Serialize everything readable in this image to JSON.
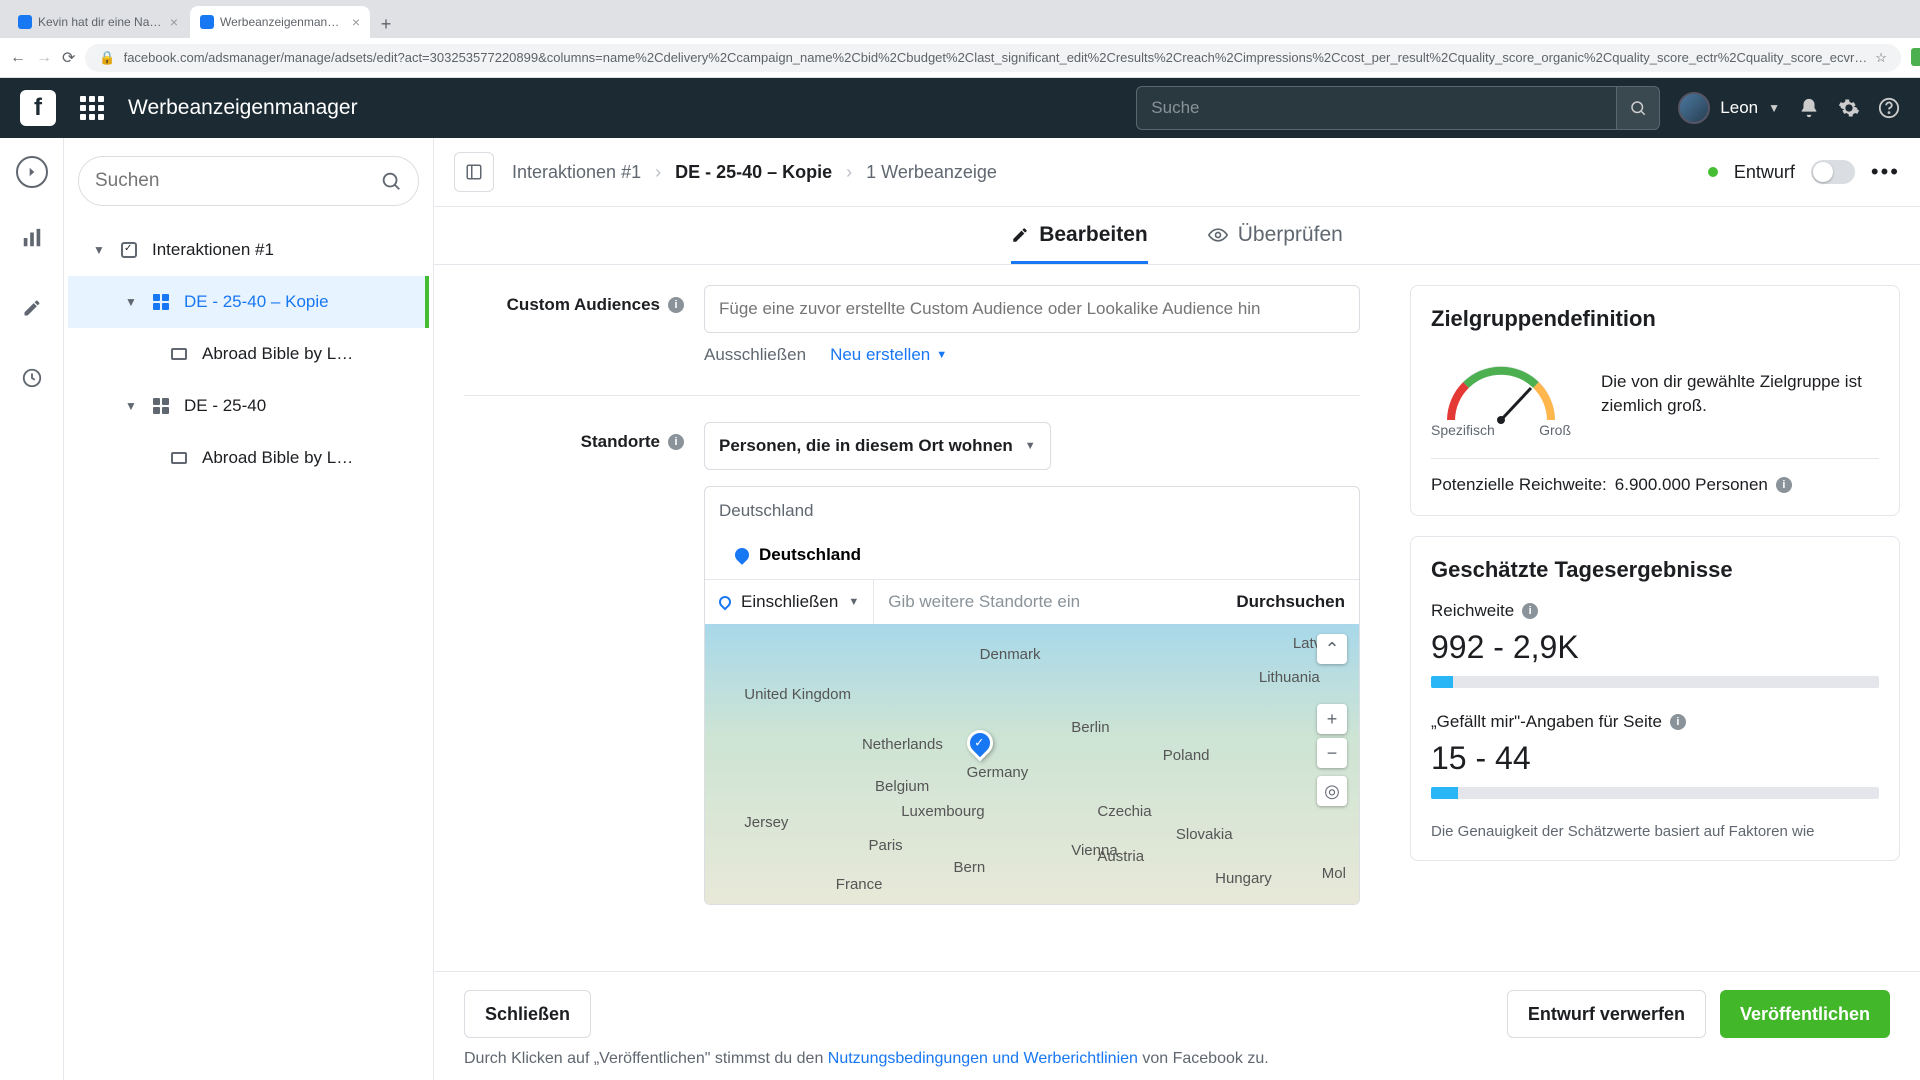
{
  "browser": {
    "tabs": [
      {
        "title": "Kevin hat dir eine Nachricht g…"
      },
      {
        "title": "Werbeanzeigenmanager – We…"
      }
    ],
    "url": "facebook.com/adsmanager/manage/adsets/edit?act=303253577220899&columns=name%2Cdelivery%2Ccampaign_name%2Cbid%2Cbudget%2Clast_significant_edit%2Cresults%2Creach%2Cimpressions%2Ccost_per_result%2Cquality_score_organic%2Cquality_score_ectr%2Cquality_score_ecvr…"
  },
  "topnav": {
    "brand": "Werbeanzeigenmanager",
    "search_placeholder": "Suche",
    "user": "Leon"
  },
  "tree": {
    "search_placeholder": "Suchen",
    "items": [
      {
        "label": "Interaktionen #1",
        "level": 1,
        "selected": false
      },
      {
        "label": "DE - 25-40 – Kopie",
        "level": 2,
        "selected": true
      },
      {
        "label": "Abroad Bible by L…",
        "level": 3,
        "selected": false
      },
      {
        "label": "DE - 25-40",
        "level": 2,
        "selected": false
      },
      {
        "label": "Abroad Bible by L…",
        "level": 3,
        "selected": false
      }
    ]
  },
  "header": {
    "breadcrumb": [
      {
        "label": "Interaktionen #1"
      },
      {
        "label": "DE - 25-40 – Kopie"
      },
      {
        "label": "1 Werbeanzeige"
      }
    ],
    "status": "Entwurf"
  },
  "tabs": {
    "edit": "Bearbeiten",
    "review": "Überprüfen"
  },
  "form": {
    "custom_audiences": {
      "label": "Custom Audiences",
      "placeholder": "Füge eine zuvor erstellte Custom Audience oder Lookalike Audience hin",
      "exclude": "Ausschließen",
      "create": "Neu erstellen"
    },
    "locations": {
      "label": "Standorte",
      "selector": "Personen, die in diesem Ort wohnen",
      "region_header": "Deutschland",
      "region_item": "Deutschland",
      "include": "Einschließen",
      "input_placeholder": "Gib weitere Standorte ein",
      "browse": "Durchsuchen",
      "map_labels": {
        "uk": "United Kingdom",
        "dk": "Denmark",
        "lv": "Latvia",
        "lt": "Lithuania",
        "nl": "Netherlands",
        "de": "Germany",
        "be": "Belgium",
        "pl": "Poland",
        "cz": "Czechia",
        "lu": "Luxembourg",
        "fr": "France",
        "at": "Austria",
        "sk": "Slovakia",
        "hu": "Hungary",
        "paris": "Paris",
        "berlin": "Berlin",
        "vienna": "Vienna",
        "bern": "Bern",
        "jersey": "Jersey",
        "mol": "Mol"
      }
    }
  },
  "insights": {
    "audience": {
      "title": "Zielgruppendefinition",
      "spec": "Spezifisch",
      "broad": "Groß",
      "desc": "Die von dir gewählte Zielgruppe ist ziemlich groß.",
      "reach_label": "Potenzielle Reichweite:",
      "reach_value": "6.900.000 Personen"
    },
    "daily": {
      "title": "Geschätzte Tagesergebnisse",
      "reach_label": "Reichweite",
      "reach_value": "992 - 2,9K",
      "likes_label": "„Gefällt mir\"-Angaben für Seite",
      "likes_value": "15 - 44",
      "cutoff": "Die Genauigkeit der Schätzwerte basiert auf Faktoren wie"
    }
  },
  "footer": {
    "close": "Schließen",
    "discard": "Entwurf verwerfen",
    "publish": "Veröffentlichen",
    "note_prefix": "Durch Klicken auf „Veröffentlichen\" stimmst du den ",
    "note_link": "Nutzungsbedingungen und Werberichtlinien",
    "note_suffix": " von Facebook zu."
  }
}
